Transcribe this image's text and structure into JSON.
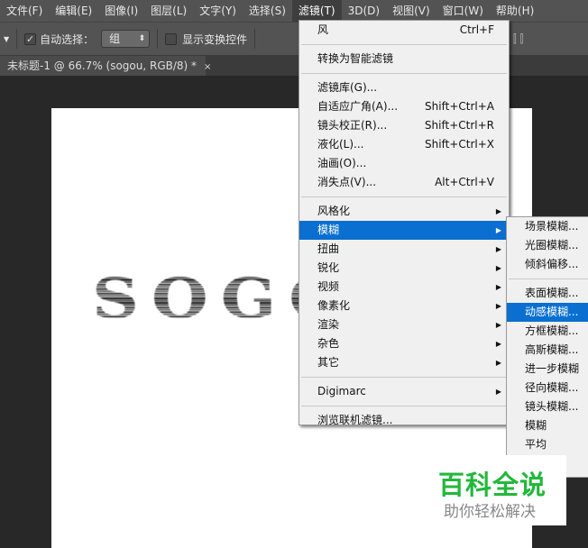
{
  "menubar": [
    "文件(F)",
    "编辑(E)",
    "图像(I)",
    "图层(L)",
    "文字(Y)",
    "选择(S)",
    "滤镜(T)",
    "3D(D)",
    "视图(V)",
    "窗口(W)",
    "帮助(H)"
  ],
  "toolbar": {
    "auto_select_label": "自动选择：",
    "auto_select_value": "组",
    "show_transform_label": "显示变换控件"
  },
  "tab": {
    "title": "未标题-1 @ 66.7% (sogou, RGB/8) *",
    "close": "×"
  },
  "canvas_text": "SOGOU",
  "filter_menu": {
    "group1": [
      {
        "label": "风",
        "shortcut": "Ctrl+F"
      }
    ],
    "group2": [
      {
        "label": "转换为智能滤镜"
      }
    ],
    "group3": [
      {
        "label": "滤镜库(G)..."
      },
      {
        "label": "自适应广角(A)...",
        "shortcut": "Shift+Ctrl+A"
      },
      {
        "label": "镜头校正(R)...",
        "shortcut": "Shift+Ctrl+R"
      },
      {
        "label": "液化(L)...",
        "shortcut": "Shift+Ctrl+X"
      },
      {
        "label": "油画(O)..."
      },
      {
        "label": "消失点(V)...",
        "shortcut": "Alt+Ctrl+V"
      }
    ],
    "group4": [
      {
        "label": "风格化"
      },
      {
        "label": "模糊"
      },
      {
        "label": "扭曲"
      },
      {
        "label": "锐化"
      },
      {
        "label": "视频"
      },
      {
        "label": "像素化"
      },
      {
        "label": "渲染"
      },
      {
        "label": "杂色"
      },
      {
        "label": "其它"
      }
    ],
    "group5": [
      {
        "label": "Digimarc"
      }
    ],
    "group6": [
      {
        "label": "浏览联机滤镜..."
      }
    ]
  },
  "blur_submenu": {
    "group1": [
      "场景模糊...",
      "光圈模糊...",
      "倾斜偏移..."
    ],
    "group2": [
      "表面模糊...",
      "动感模糊...",
      "方框模糊...",
      "高斯模糊...",
      "进一步模糊",
      "径向模糊...",
      "镜头模糊...",
      "模糊",
      "平均",
      "...",
      "..."
    ]
  },
  "watermark": {
    "title": "百科全说",
    "subtitle": "助你轻松解决"
  },
  "colors": {
    "highlight": "#0a6fd0",
    "watermark_green": "#22b83a"
  }
}
